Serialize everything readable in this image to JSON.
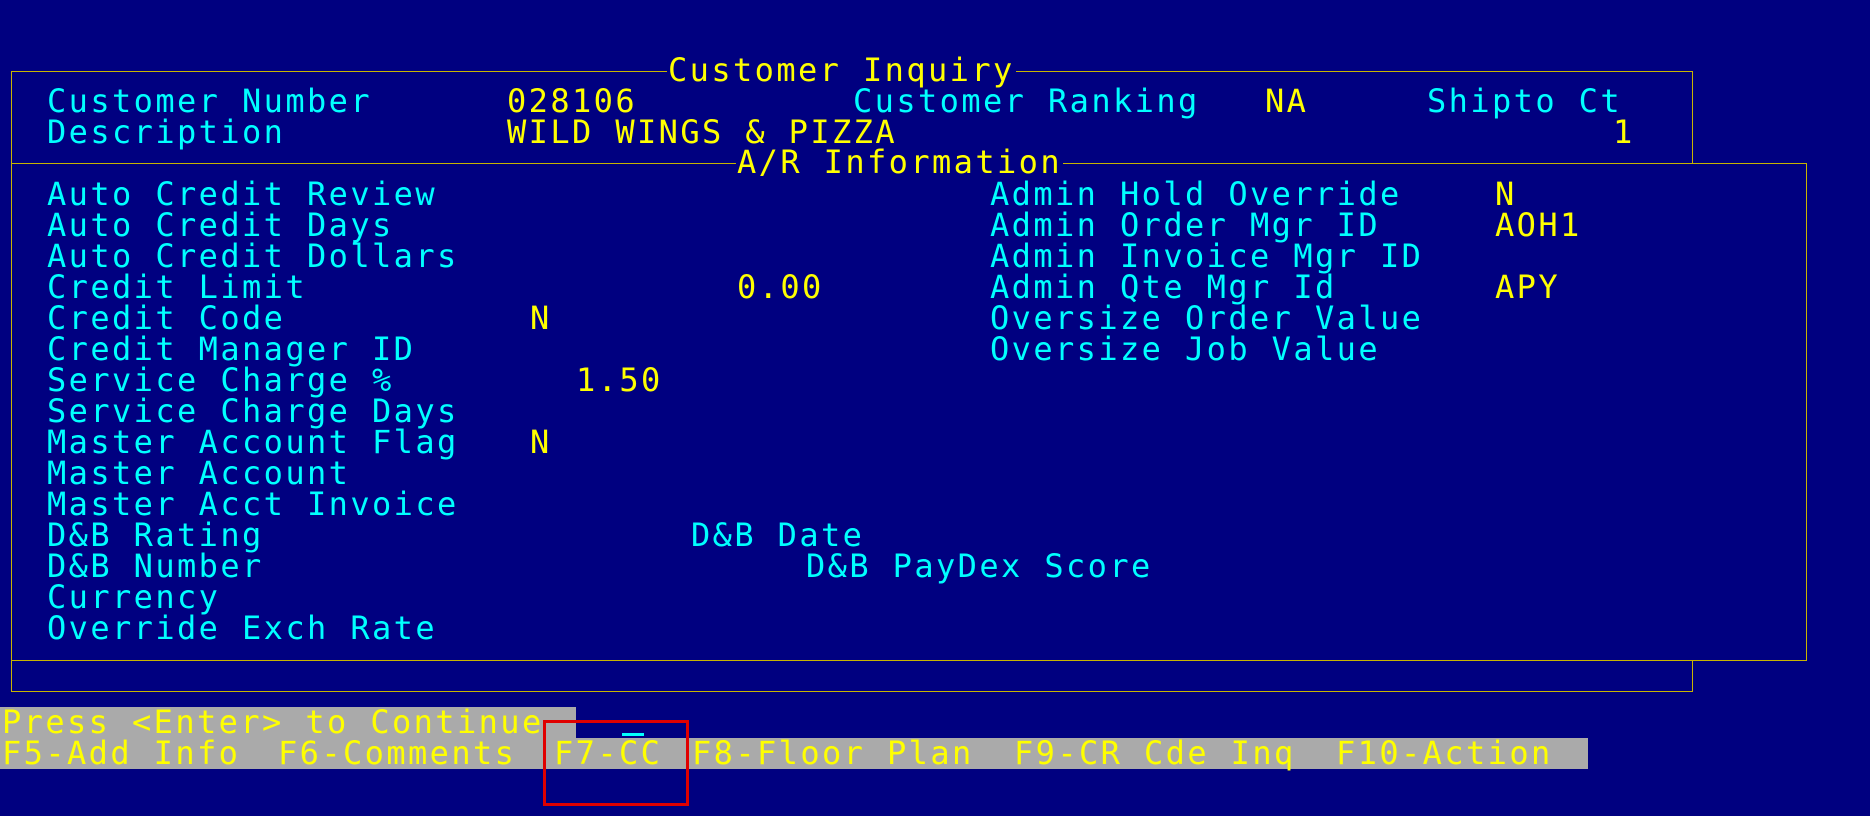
{
  "window": {
    "title": "Customer Inquiry",
    "section_title": "A/R Information"
  },
  "header": {
    "customer_number_label": "Customer Number",
    "customer_number": "028106",
    "ranking_label": "Customer Ranking",
    "ranking": "NA",
    "shipto_label": "Shipto Ct",
    "shipto_count": "1",
    "description_label": "Description",
    "description": "WILD WINGS & PIZZA"
  },
  "ar": {
    "left": [
      {
        "label": "Auto Credit Review",
        "value": ""
      },
      {
        "label": "Auto Credit Days",
        "value": ""
      },
      {
        "label": "Auto Credit Dollars",
        "value": ""
      },
      {
        "label": "Credit Limit",
        "value": "0.00"
      },
      {
        "label": "Credit Code",
        "value": "N"
      },
      {
        "label": "Credit Manager ID",
        "value": ""
      },
      {
        "label": "Service Charge %",
        "value": "1.50"
      },
      {
        "label": "Service Charge Days",
        "value": ""
      },
      {
        "label": "Master Account Flag",
        "value": "N"
      },
      {
        "label": "Master Account",
        "value": ""
      },
      {
        "label": "Master Acct Invoice",
        "value": ""
      },
      {
        "label": "D&B Rating",
        "value": ""
      },
      {
        "label": "D&B Number",
        "value": ""
      },
      {
        "label": "Currency",
        "value": ""
      },
      {
        "label": "Override Exch Rate",
        "value": ""
      }
    ],
    "right": [
      {
        "label": "Admin Hold Override",
        "value": "N"
      },
      {
        "label": "Admin Order Mgr ID",
        "value": "AOH1"
      },
      {
        "label": "Admin Invoice Mgr ID",
        "value": ""
      },
      {
        "label": "Admin Qte Mgr Id",
        "value": "APY"
      },
      {
        "label": "Oversize Order Value",
        "value": ""
      },
      {
        "label": "Oversize Job Value",
        "value": ""
      }
    ],
    "db_date_label": "D&B Date",
    "db_paydex_label": "D&B PayDex Score"
  },
  "prompt": "Press <Enter> to Continue",
  "fkeys": {
    "f5": "F5-Add Info",
    "f6": "F6-Comments",
    "f7": "F7-CC",
    "f8": "F8-Floor Plan",
    "f9": "F9-CR Cde Inq",
    "f10": "F10-Action"
  }
}
